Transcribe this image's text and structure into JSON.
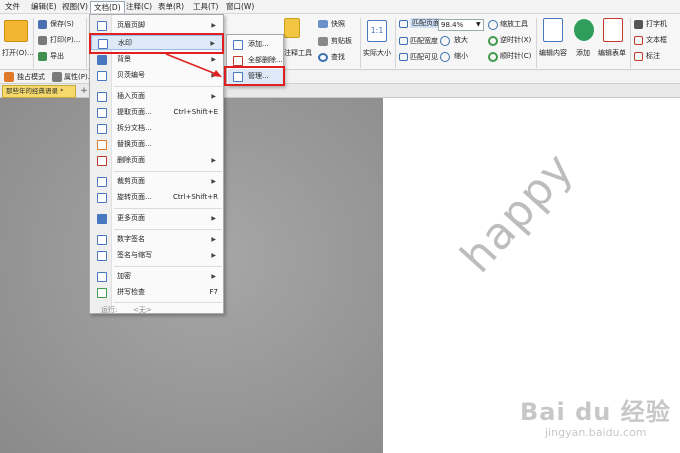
{
  "menubar": {
    "items": [
      "文件",
      "编辑(E)",
      "视图(V)",
      "文档(D)",
      "注释(C)",
      "表单(R)",
      "工具(T)",
      "窗口(W)"
    ],
    "active_index": 3
  },
  "ribbon": {
    "open_label": "打开(O)...",
    "save_label": "保存(S)",
    "print_label": "打印(P)...",
    "export_label": "导出",
    "mode_label": "独占模式",
    "props_label": "属性(P)...",
    "header_footer": "页眉页脚",
    "quick_label": "快照",
    "clipboard_label": "剪贴板",
    "find_label": "查找",
    "comment_tools": "注释工具",
    "actual_size": "实际大小",
    "fit_page": "匹配页面",
    "fit_width": "匹配宽度",
    "fit_visible": "匹配可见",
    "zoom_value": "98.4%",
    "zoom_in": "放大",
    "zoom_out": "缩小",
    "zoom_tool": "缩放工具",
    "rotate_cw": "逆时针(X)",
    "rotate_ccw": "顺时针(C)",
    "edit_content": "编辑内容",
    "add_label": "添加",
    "edit_form": "编辑表单",
    "typewriter": "打字机",
    "textbox": "文本框",
    "callout": "标注"
  },
  "tabbar": {
    "doc_tab": "那些年的经典语录 *",
    "add_symbol": "+"
  },
  "document_menu": {
    "items": [
      {
        "label": "页眉页脚",
        "shortcut": "",
        "submenu": true
      },
      {
        "label": "水印",
        "shortcut": "",
        "submenu": true
      },
      {
        "label": "背景",
        "shortcut": "",
        "submenu": true
      },
      {
        "label": "贝茨编号",
        "shortcut": "",
        "submenu": true
      },
      {
        "label": "插入页面",
        "shortcut": "",
        "submenu": true
      },
      {
        "label": "提取页面...",
        "shortcut": "Ctrl+Shift+E",
        "submenu": false
      },
      {
        "label": "拆分文档...",
        "shortcut": "",
        "submenu": false
      },
      {
        "label": "替换页面...",
        "shortcut": "",
        "submenu": false
      },
      {
        "label": "删除页面",
        "shortcut": "",
        "submenu": true
      },
      {
        "label": "裁剪页面",
        "shortcut": "",
        "submenu": true
      },
      {
        "label": "旋转页面...",
        "shortcut": "Ctrl+Shift+R",
        "submenu": false
      },
      {
        "label": "更多页面",
        "shortcut": "",
        "submenu": true
      },
      {
        "label": "数字签名",
        "shortcut": "",
        "submenu": true
      },
      {
        "label": "签名与缩写",
        "shortcut": "",
        "submenu": true
      },
      {
        "label": "加密",
        "shortcut": "",
        "submenu": true
      },
      {
        "label": "拼写检查",
        "shortcut": "F7",
        "submenu": false
      }
    ],
    "run_label": "运行:",
    "run_value": "<无>"
  },
  "watermark_submenu": {
    "items": [
      "添加...",
      "全部删除...",
      "管理..."
    ]
  },
  "page": {
    "watermark_text": "happy"
  },
  "site_watermark": {
    "brand": "Bai du 经验",
    "url": "jingyan.baidu.com"
  },
  "colors": {
    "highlight": "#dde9f7",
    "annotation_red": "#e02020",
    "doc_tab_yellow": "#f5d96a"
  }
}
